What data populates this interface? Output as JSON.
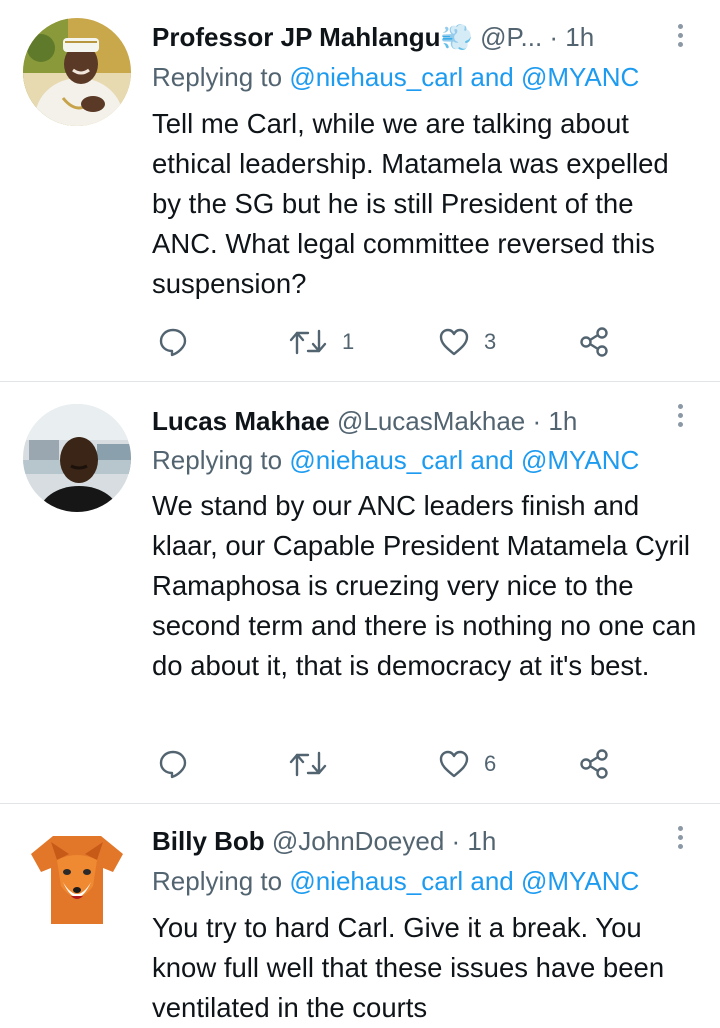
{
  "tweets": [
    {
      "display_name": "Professor JP Mahlangu",
      "emoji": "💨",
      "handle": "@P...",
      "dot": " · ",
      "time": "1h",
      "reply_prefix": "Replying to ",
      "reply_mentions": "@niehaus_carl and @MYANC",
      "text": "Tell me Carl, while we are talking about ethical leadership. Matamela was expelled by the SG but he is still President of the ANC. What legal committee reversed this suspension?",
      "retweet_count": "1",
      "like_count": "3"
    },
    {
      "display_name": "Lucas Makhae",
      "handle": "@LucasMakhae",
      "dot": " · ",
      "time": "1h",
      "reply_prefix": "Replying to ",
      "reply_mentions": "@niehaus_carl and @MYANC",
      "text": "We stand by our ANC leaders finish and klaar, our Capable President Matamela Cyril Ramaphosa is cruezing very nice to the second term and there is nothing no one can do about it, that is democracy at it's best.",
      "retweet_count": "",
      "like_count": "6"
    },
    {
      "display_name": "Billy Bob",
      "handle": "@JohnDoeyed",
      "dot": " · ",
      "time": "1h",
      "reply_prefix": "Replying to ",
      "reply_mentions": "@niehaus_carl and @MYANC",
      "text": "You try to hard Carl. Give it a break. You know full well that these issues have been ventilated in the courts"
    }
  ],
  "icons": {
    "reply": "reply-icon",
    "retweet": "retweet-icon",
    "like": "heart-icon",
    "share": "share-icon",
    "more": "more-options-icon"
  },
  "colors": {
    "link": "#1d9bf0",
    "secondary_text": "#536471",
    "primary_text": "#0f1419",
    "divider": "#e1e5e8"
  }
}
